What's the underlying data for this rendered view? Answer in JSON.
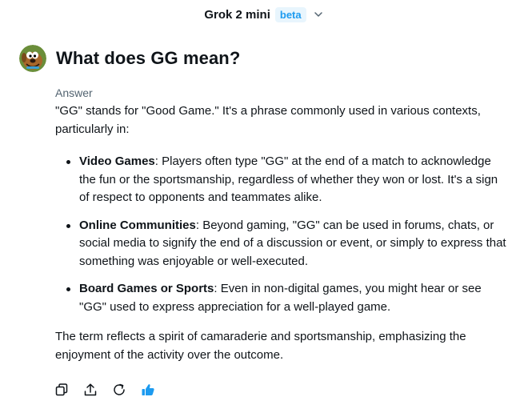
{
  "header": {
    "model_name": "Grok 2 mini",
    "model_badge": "beta"
  },
  "question": {
    "text": "What does GG mean?"
  },
  "answer": {
    "label": "Answer",
    "intro": "\"GG\" stands for \"Good Game.\" It's a phrase commonly used in various contexts, particularly in:",
    "items": [
      {
        "title": "Video Games",
        "text": ": Players often type \"GG\" at the end of a match to acknowledge the fun or the sportsmanship, regardless of whether they won or lost. It's a sign of respect to opponents and teammates alike."
      },
      {
        "title": "Online Communities",
        "text": ": Beyond gaming, \"GG\" can be used in forums, chats, or social media to signify the end of a discussion or event, or simply to express that something was enjoyable or well-executed."
      },
      {
        "title": "Board Games or Sports",
        "text": ": Even in non-digital games, you might hear or see \"GG\" used to express appreciation for a well-played game."
      }
    ],
    "closing": "The term reflects a spirit of camaraderie and sportsmanship, emphasizing the enjoyment of the activity over the outcome."
  },
  "actions": {
    "icons": [
      "copy-icon",
      "share-icon",
      "regenerate-icon",
      "thumbs-up-icon"
    ]
  },
  "colors": {
    "text": "#0f1419",
    "muted": "#536471",
    "accent": "#1d9bf0",
    "badge_bg": "#e8f5fd"
  }
}
